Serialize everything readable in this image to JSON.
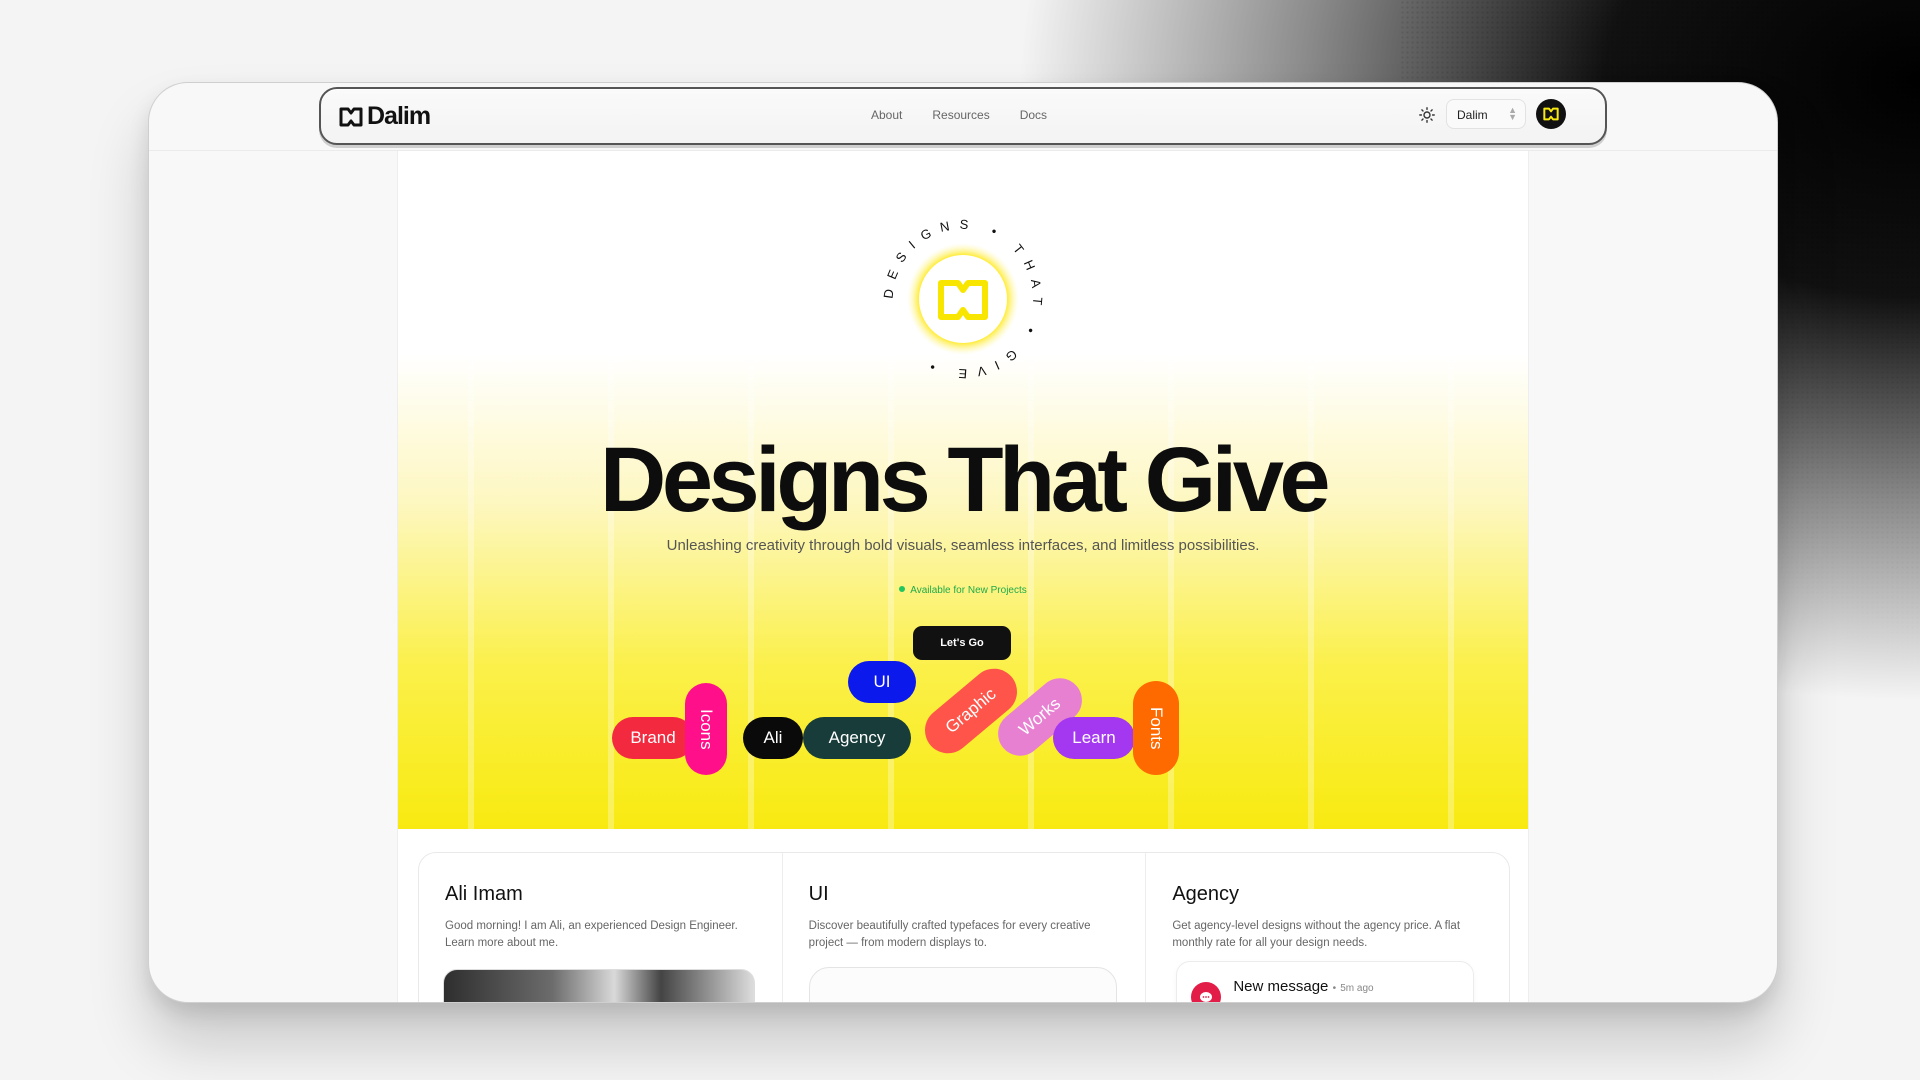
{
  "nav": {
    "brand": "Dalim",
    "links": [
      "About",
      "Resources",
      "Docs"
    ],
    "team_select": "Dalim",
    "icons": {
      "theme": "sun-icon",
      "chevron": "chevron-updown-icon",
      "avatar": "dalim-logo-icon"
    }
  },
  "hero": {
    "badge_text": "DESIGNS • THAT • GIVE •",
    "headline": "Designs That Give",
    "subtitle": "Unleashing creativity through bold visuals, seamless interfaces, and limitless possibilities.",
    "status": "Available for New Projects",
    "cta": "Let's Go"
  },
  "tags": [
    {
      "label": "Brand",
      "color": "#f2293f"
    },
    {
      "label": "Icons",
      "color": "#ff0f8a"
    },
    {
      "label": "Ali",
      "color": "#0a0a0a"
    },
    {
      "label": "Agency",
      "color": "#173c3a"
    },
    {
      "label": "UI",
      "color": "#0b19ec"
    },
    {
      "label": "Graphic",
      "color": "#ff5449"
    },
    {
      "label": "Works",
      "color": "#e880d2"
    },
    {
      "label": "Learn",
      "color": "#a437f0"
    },
    {
      "label": "Fonts",
      "color": "#ff6a00"
    }
  ],
  "cards": [
    {
      "title": "Ali Imam",
      "desc": "Good morning! I am Ali, an experienced Design Engineer. Learn more about me."
    },
    {
      "title": "UI",
      "desc": "Discover beautifully crafted typefaces for every creative project — from modern displays to."
    },
    {
      "title": "Agency",
      "desc": "Get agency-level designs without the agency price. A flat monthly rate for all your design needs."
    }
  ],
  "notification": {
    "title": "New message",
    "time": "5m ago",
    "separator": "•"
  },
  "colors": {
    "accent_yellow": "#f8ea10",
    "status_green": "#22c55e",
    "dark": "#111111"
  }
}
